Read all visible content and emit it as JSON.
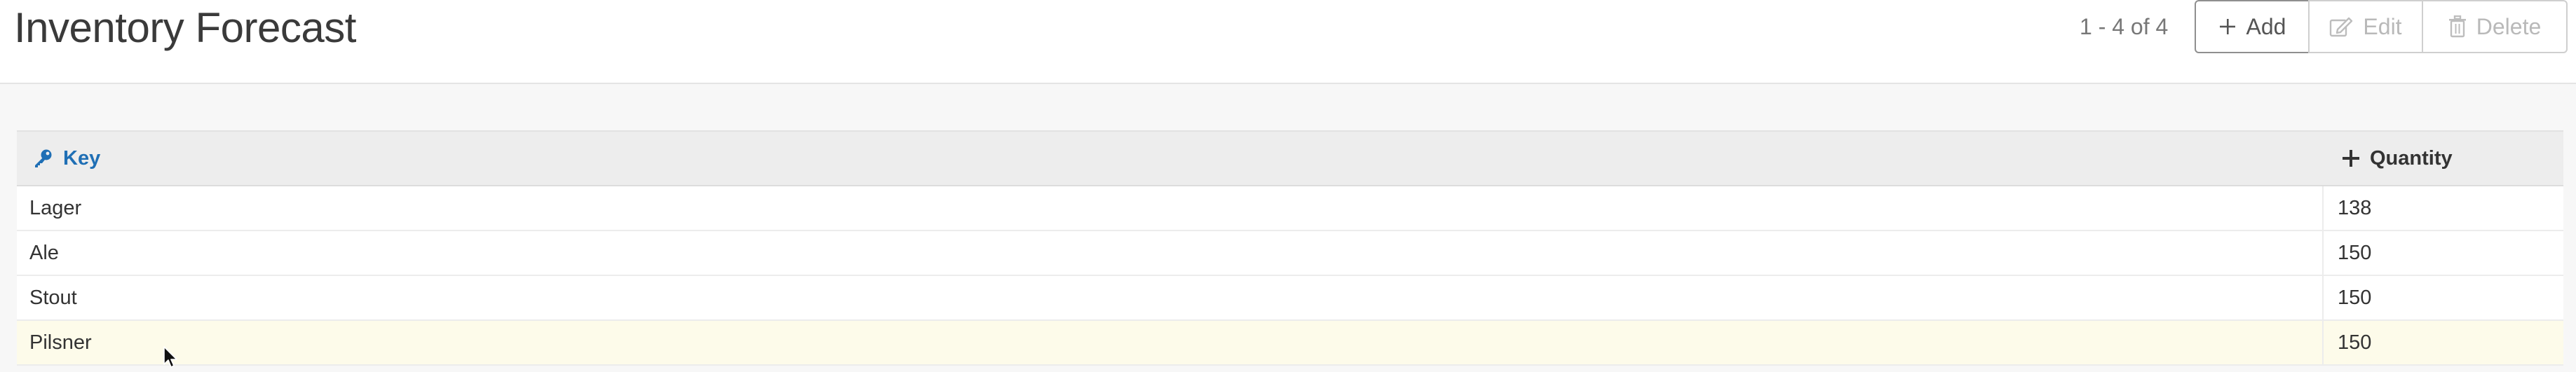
{
  "header": {
    "title": "Inventory Forecast",
    "pager_text": "1 - 4 of 4",
    "buttons": {
      "add_label": "Add",
      "edit_label": "Edit",
      "delete_label": "Delete"
    }
  },
  "table": {
    "columns": {
      "key_label": "Key",
      "quantity_label": "Quantity"
    },
    "rows": [
      {
        "key": "Lager",
        "quantity": "138"
      },
      {
        "key": "Ale",
        "quantity": "150"
      },
      {
        "key": "Stout",
        "quantity": "150"
      },
      {
        "key": "Pilsner",
        "quantity": "150"
      }
    ],
    "highlighted_row": 3
  },
  "icons": {
    "add": "plus-icon",
    "edit": "edit-icon",
    "delete": "trash-icon",
    "key_column": "key-icon",
    "quantity_column": "plus-icon"
  },
  "colors": {
    "accent": "#1f6fb5",
    "highlight_row": "#fdfbea"
  }
}
